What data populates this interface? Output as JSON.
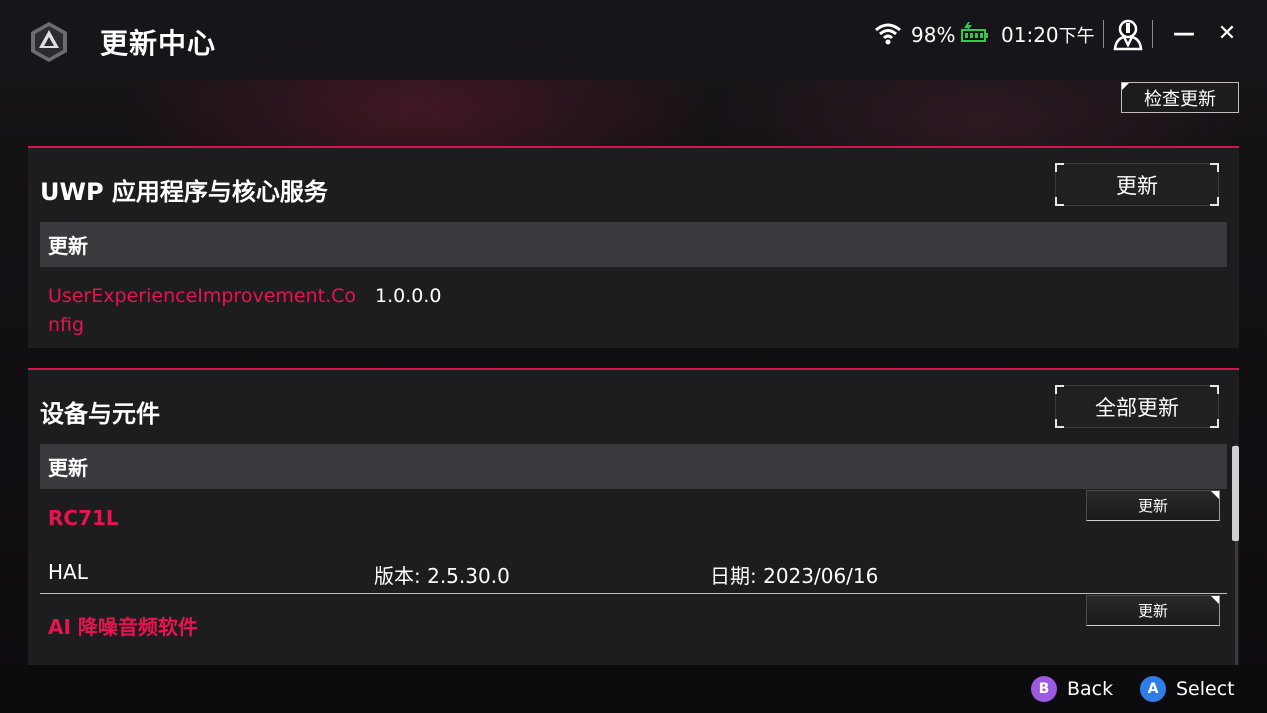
{
  "app": {
    "title": "更新中心",
    "logo_icon": "rog-logo-icon"
  },
  "status_bar": {
    "wifi_icon": "wifi-icon",
    "battery_percent": "98%",
    "battery_icon": "battery-charging-icon",
    "time": "01:20",
    "time_suffix": "下午",
    "user_icon": "user-icon",
    "minimize_label": "—",
    "close_label": "✕"
  },
  "toolbar": {
    "check_update_label": "检查更新"
  },
  "uwp_section": {
    "title": "UWP 应用程序与核心服务",
    "update_button_label": "更新",
    "table_header": "更新",
    "items": [
      {
        "name": "UserExperienceImprovement.Config",
        "version": "1.0.0.0"
      }
    ]
  },
  "device_section": {
    "title": "设备与元件",
    "update_all_label": "全部更新",
    "table_header": "更新",
    "items": [
      {
        "name": "RC71L",
        "button_label": "更新",
        "sub_name": "HAL",
        "version": "版本: 2.5.30.0",
        "date": "日期: 2023/06/16"
      },
      {
        "name": "AI 降噪音频软件",
        "button_label": "更新"
      }
    ]
  },
  "footer": {
    "back_key": "B",
    "back_label": "Back",
    "select_key": "A",
    "select_label": "Select"
  },
  "colors": {
    "accent": "#e8134f",
    "back_key_color": "#9a5be0",
    "select_key_color": "#2f7de6"
  }
}
